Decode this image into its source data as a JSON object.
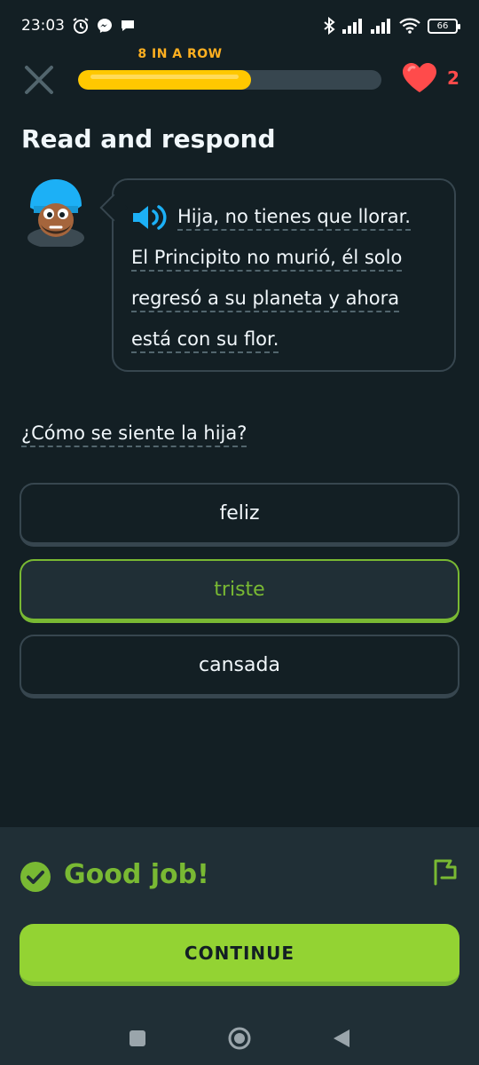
{
  "status": {
    "time": "23:03",
    "battery": "66"
  },
  "header": {
    "streak_label": "8 IN A ROW",
    "progress": 0.57,
    "hearts": "2"
  },
  "title": "Read and respond",
  "passage": {
    "lines": [
      "Hija, no tienes que llorar.",
      "El Principito no murió, él solo",
      "regresó a su planeta y ahora",
      "está con su flor."
    ]
  },
  "question": "¿Cómo se siente la hija?",
  "options": [
    {
      "label": "feliz",
      "selected": false
    },
    {
      "label": "triste",
      "selected": true
    },
    {
      "label": "cansada",
      "selected": false
    }
  ],
  "feedback": {
    "message": "Good job!",
    "continue_label": "CONTINUE"
  },
  "colors": {
    "background": "#131f24",
    "accent_green": "#79b933",
    "button_green": "#93d333",
    "streak_orange": "#ffb020",
    "heart_red": "#ff4b4b"
  },
  "icons": [
    "close-icon",
    "heart-icon",
    "speaker-icon",
    "check-icon",
    "flag-icon",
    "alarm-icon",
    "messenger-icon",
    "chat-icon",
    "bluetooth-icon",
    "signal-icon",
    "wifi-icon",
    "battery-icon",
    "square-nav-icon",
    "home-nav-icon",
    "back-nav-icon"
  ]
}
